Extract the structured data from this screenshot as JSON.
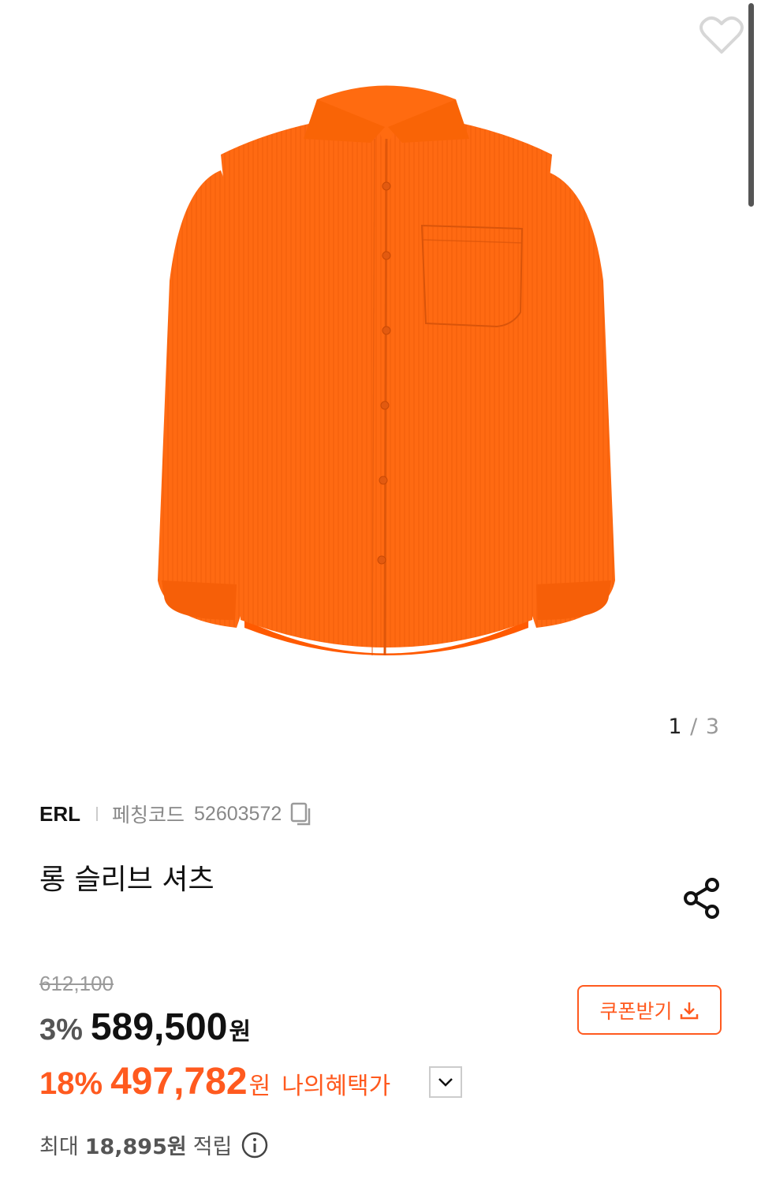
{
  "gallery": {
    "current": "1",
    "separator": "/",
    "total": "3",
    "product_color": "#ff6a12"
  },
  "product": {
    "brand": "ERL",
    "code_label": "페칭코드",
    "code_value": "52603572",
    "title": "롱 슬리브 셔츠"
  },
  "price": {
    "original": "612,100",
    "discount_pct": "3%",
    "sale": "589,500",
    "won": "원",
    "benefit_pct": "18%",
    "benefit_price": "497,782",
    "benefit_won": "원",
    "benefit_label": "나의혜택가"
  },
  "coupon": {
    "label": "쿠폰받기"
  },
  "points": {
    "prefix": "최대",
    "value": "18,895원",
    "suffix": "적립"
  },
  "colors": {
    "accent": "#ff5a1f",
    "muted": "#888888"
  },
  "icons": [
    "heart-icon",
    "copy-icon",
    "share-icon",
    "download-icon",
    "chevron-down-icon",
    "info-icon"
  ]
}
